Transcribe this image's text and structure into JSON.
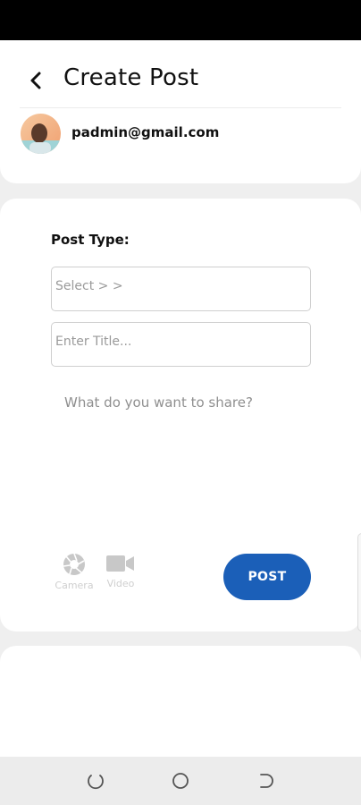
{
  "header": {
    "title": "Create Post",
    "user_email": "padmin@gmail.com"
  },
  "form": {
    "post_type_label": "Post Type:",
    "select_placeholder": "Select > >",
    "title_placeholder": "Enter Title...",
    "share_placeholder": "What do you want to share?"
  },
  "actions": {
    "camera_label": "Camera",
    "video_label": "Video",
    "post_label": "POST"
  },
  "colors": {
    "accent": "#1b5fb8",
    "status_bar": "#000000",
    "background": "#efefef"
  },
  "icons": {
    "back": "chevron-left-icon",
    "camera": "camera-aperture-icon",
    "video": "video-camera-icon",
    "nav_recents": "recents-icon",
    "nav_home": "home-circle-icon",
    "nav_back": "back-icon"
  }
}
